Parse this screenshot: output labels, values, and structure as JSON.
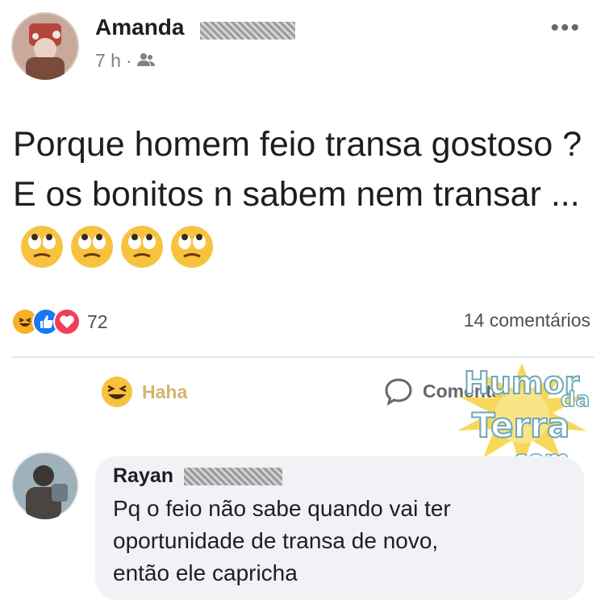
{
  "post": {
    "author_name": "Amanda",
    "time": "7 h",
    "separator": "·",
    "audience_icon": "friends-icon",
    "more_label": "•••",
    "text": "Porque homem feio transa gostoso ? E os bonitos n sabem nem transar ...",
    "emoji": [
      "face-with-rolling-eyes",
      "face-with-rolling-eyes",
      "face-with-rolling-eyes",
      "face-with-rolling-eyes"
    ],
    "reactions": {
      "icons": [
        "haha-icon",
        "like-icon",
        "love-icon"
      ],
      "count": "72"
    },
    "comments_count": "14 comentários"
  },
  "actions": {
    "haha_label": "Haha",
    "comment_label": "Comentar"
  },
  "watermark": {
    "line1": "Humor",
    "line2": "da",
    "line3": "Terra",
    "line4": ".com"
  },
  "comment": {
    "author_name": "Rayan",
    "text_lines": [
      "Pq o feio não sabe quando vai ter",
      "oportunidade de transa de novo,",
      "então ele capricha"
    ]
  },
  "colors": {
    "accent_blue": "#1877f2",
    "love_red": "#f33e58",
    "haha_yellow": "#f7b125",
    "bubble_bg": "#f1f2f6"
  }
}
